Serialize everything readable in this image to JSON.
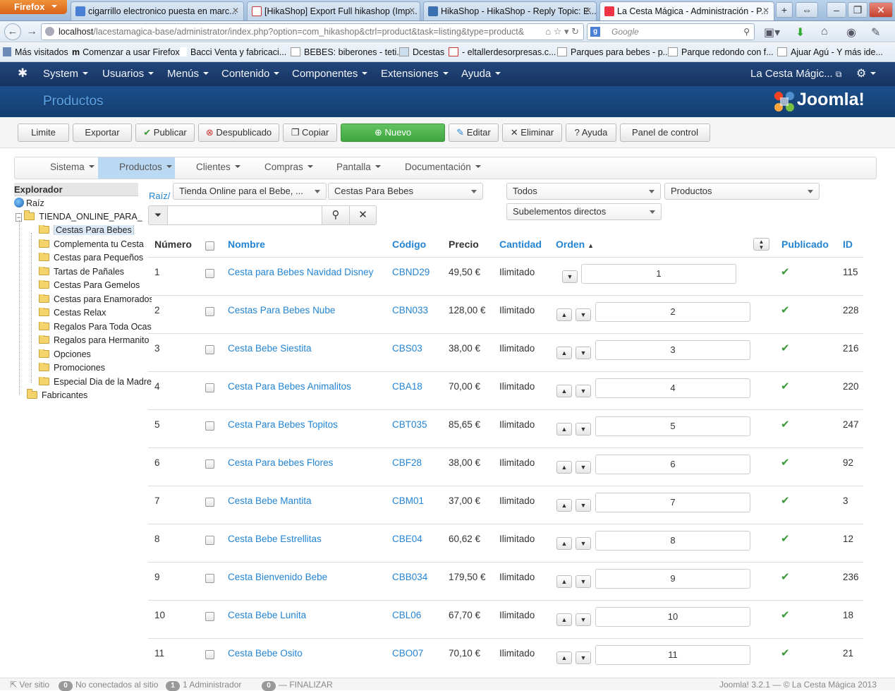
{
  "browser": {
    "app_button": "Firefox",
    "tabs": [
      {
        "title": "cigarrillo electronico puesta en marc..."
      },
      {
        "title": "[HikaShop] Export Full hikashop (Imp..."
      },
      {
        "title": "HikaShop - HikaShop - Reply Topic: E..."
      },
      {
        "title": "La Cesta Mágica - Administración - P..."
      }
    ],
    "new_tab": "+",
    "url_host": "localhost",
    "url_path": "/lacestamagica-base/administrator/index.php?option=com_hikashop&ctrl=product&task=listing&type=product&",
    "search_placeholder": "Google",
    "bookmarks": [
      "Más visitados",
      "Comenzar a usar Firefox",
      "Bacci Venta y fabricaci...",
      "BEBES: biberones - teti...",
      "Dcestas",
      "- eltallerdesorpresas.c...",
      "Parques para bebes - p...",
      "Parque redondo con f...",
      "Ajuar Agú - Y más ide..."
    ]
  },
  "joomla_nav": {
    "items": [
      "System",
      "Usuarios",
      "Menús",
      "Contenido",
      "Componentes",
      "Extensiones",
      "Ayuda"
    ],
    "site_link": "La Cesta Mágic..."
  },
  "page": {
    "title": "Productos",
    "logo_text": "Joomla!"
  },
  "toolbar": {
    "limite": "Limite",
    "exportar": "Exportar",
    "publicar": "Publicar",
    "despublicado": "Despublicado",
    "copiar": "Copiar",
    "nuevo": "Nuevo",
    "editar": "Editar",
    "eliminar": "Eliminar",
    "ayuda": "Ayuda",
    "panel": "Panel de control"
  },
  "hika_menu": [
    "Sistema",
    "Productos",
    "Clientes",
    "Compras",
    "Pantalla",
    "Documentación"
  ],
  "explorer": {
    "title": "Explorador",
    "root": "Raíz",
    "store": "TIENDA_ONLINE_PARA_",
    "categories": [
      "Cestas Para Bebes",
      "Complementa tu Cesta",
      "Cestas para Pequeños",
      "Tartas de Pañales",
      "Cestas Para Gemelos",
      "Cestas para Enamorados",
      "Cestas Relax",
      "Regalos Para Toda Ocasion",
      "Regalos para Hermanito",
      "Opciones",
      "Promociones",
      "Especial Dia de la Madre"
    ],
    "manufacturers": "Fabricantes"
  },
  "filters": {
    "breadcrumb": "Raíz/",
    "store_select": "Tienda Online para el Bebe, ...",
    "category_select": "Cestas Para Bebes",
    "state_select": "Todos",
    "type_select": "Productos",
    "depth_select": "Subelementos directos",
    "search_value": ""
  },
  "table": {
    "headers": {
      "numero": "Número",
      "nombre": "Nombre",
      "codigo": "Código",
      "precio": "Precio",
      "cantidad": "Cantidad",
      "orden": "Orden",
      "publicado": "Publicado",
      "id": "ID"
    },
    "rows": [
      {
        "num": "1",
        "name": "Cesta para Bebes Navidad Disney",
        "code": "CBND29",
        "price": "49,50 €",
        "qty": "Ilimitado",
        "order": "1",
        "id": "115"
      },
      {
        "num": "2",
        "name": "Cestas Para Bebes Nube",
        "code": "CBN033",
        "price": "128,00 €",
        "qty": "Ilimitado",
        "order": "2",
        "id": "228"
      },
      {
        "num": "3",
        "name": "Cesta Bebe Siestita",
        "code": "CBS03",
        "price": "38,00 €",
        "qty": "Ilimitado",
        "order": "3",
        "id": "216"
      },
      {
        "num": "4",
        "name": "Cesta Para Bebes Animalitos",
        "code": "CBA18",
        "price": "70,00 €",
        "qty": "Ilimitado",
        "order": "4",
        "id": "220"
      },
      {
        "num": "5",
        "name": "Cesta Para Bebes Topitos",
        "code": "CBT035",
        "price": "85,65 €",
        "qty": "Ilimitado",
        "order": "5",
        "id": "247"
      },
      {
        "num": "6",
        "name": "Cesta Para bebes Flores",
        "code": "CBF28",
        "price": "38,00 €",
        "qty": "Ilimitado",
        "order": "6",
        "id": "92"
      },
      {
        "num": "7",
        "name": "Cesta Bebe Mantita",
        "code": "CBM01",
        "price": "37,00 €",
        "qty": "Ilimitado",
        "order": "7",
        "id": "3"
      },
      {
        "num": "8",
        "name": "Cesta Bebe Estrellitas",
        "code": "CBE04",
        "price": "60,62 €",
        "qty": "Ilimitado",
        "order": "8",
        "id": "12"
      },
      {
        "num": "9",
        "name": "Cesta Bienvenido Bebe",
        "code": "CBB034",
        "price": "179,50 €",
        "qty": "Ilimitado",
        "order": "9",
        "id": "236"
      },
      {
        "num": "10",
        "name": "Cesta Bebe Lunita",
        "code": "CBL06",
        "price": "67,70 €",
        "qty": "Ilimitado",
        "order": "10",
        "id": "18"
      },
      {
        "num": "11",
        "name": "Cesta Bebe Osito",
        "code": "CBO07",
        "price": "70,10 €",
        "qty": "Ilimitado",
        "order": "11",
        "id": "21"
      }
    ]
  },
  "status": {
    "view_site": "Ver sitio",
    "not_connected_count": "0",
    "not_connected": "No conectados al sitio",
    "admin_count": "1",
    "admin": "1 Administrador",
    "logout_count": "0",
    "logout": "FINALIZAR",
    "version": "Joomla! 3.2.1",
    "copyright": "— © La Cesta Mágica 2013"
  },
  "colors": {
    "joomla_nav_bg": "#17335f",
    "header_bg": "#1c4f8a",
    "title_color": "#5fa3e3",
    "link": "#2384d3",
    "green_button": "#4cb74c",
    "active_menu": "#bcd9f3"
  }
}
